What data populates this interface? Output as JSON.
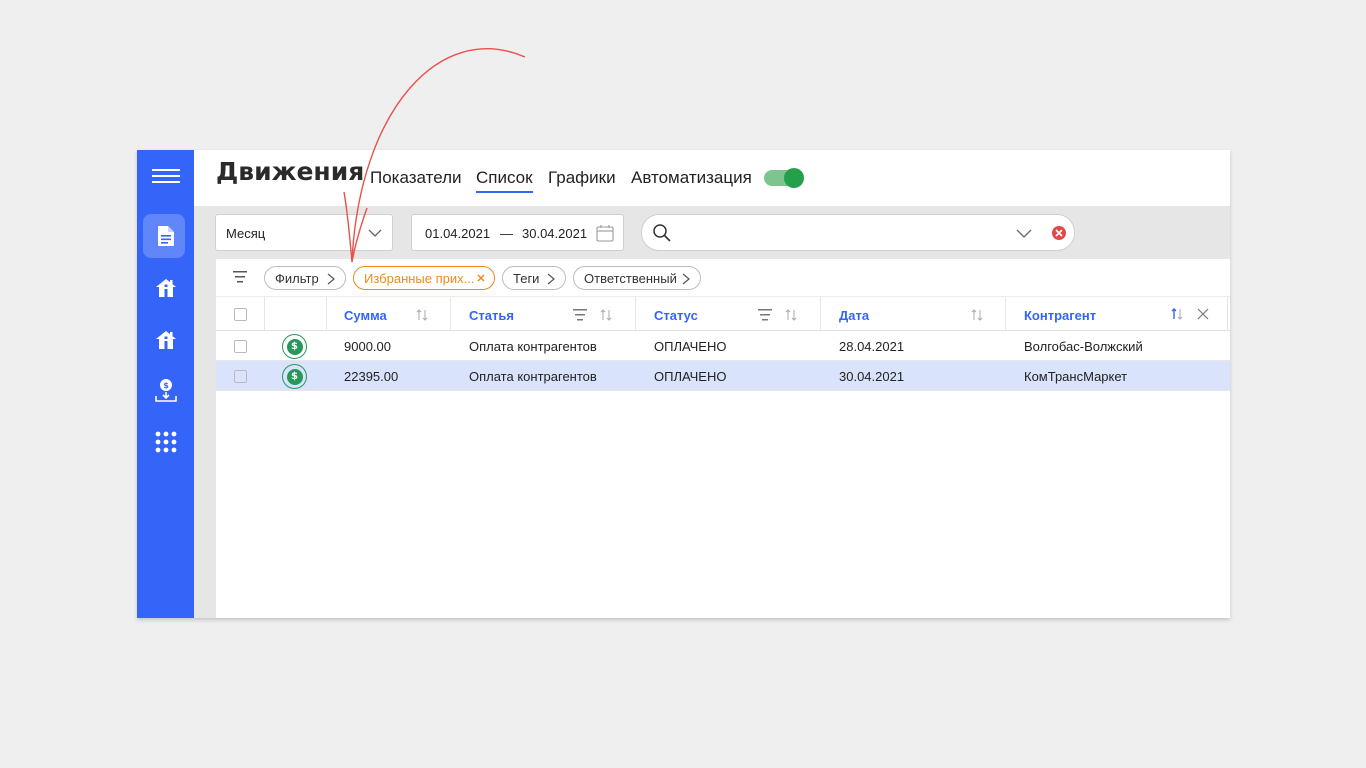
{
  "header": {
    "title": "Движения",
    "tabs": [
      {
        "label": "Показатели",
        "active": false
      },
      {
        "label": "Список",
        "active": true
      },
      {
        "label": "Графики",
        "active": false
      },
      {
        "label": "Автоматизация",
        "active": false
      }
    ],
    "toggle_on": true
  },
  "sidebar": {
    "items": [
      "menu-icon",
      "document-icon",
      "house-icon",
      "house-icon",
      "money-download-icon",
      "apps-grid-icon"
    ],
    "active_index": 1
  },
  "filters": {
    "period": "Месяц",
    "date_from": "01.04.2021",
    "date_sep": "—",
    "date_to": "30.04.2021",
    "search_value": ""
  },
  "chips": [
    {
      "label": "Фильтр",
      "type": "arrow"
    },
    {
      "label": "Избранные прих...",
      "type": "removable"
    },
    {
      "label": "Теги",
      "type": "arrow"
    },
    {
      "label": "Ответственный",
      "type": "arrow"
    }
  ],
  "table": {
    "columns": [
      "Сумма",
      "Статья",
      "Статус",
      "Дата",
      "Контрагент"
    ],
    "rows": [
      {
        "amount": "9000.00",
        "article": "Оплата контрагентов",
        "status": "ОПЛАЧЕНО",
        "date": "28.04.2021",
        "counterparty": "Волгобас-Волжский",
        "selected": false
      },
      {
        "amount": "22395.00",
        "article": "Оплата контрагентов",
        "status": "ОПЛАЧЕНО",
        "date": "30.04.2021",
        "counterparty": "КомТрансМаркет",
        "selected": true
      }
    ]
  },
  "colors": {
    "accent": "#3465f8",
    "chip_accent": "#f08a1c",
    "status_green": "#26985a",
    "annotation_red": "#e8524a"
  }
}
